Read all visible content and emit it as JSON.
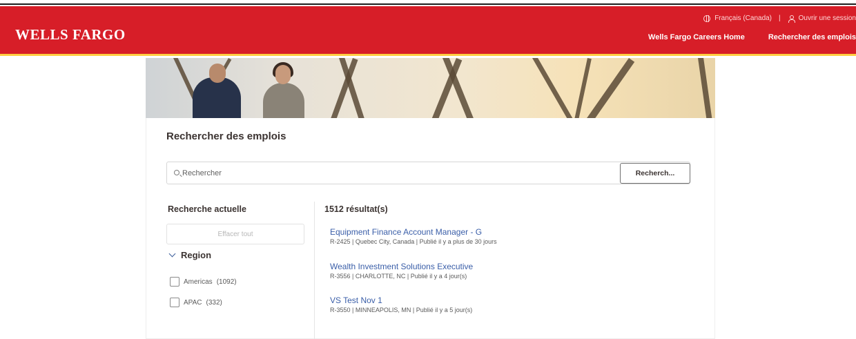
{
  "header": {
    "logo": "WELLS FARGO",
    "language": "Français (Canada)",
    "separator": "|",
    "signin": "Ouvrir une session",
    "nav": [
      "Wells Fargo Careers Home",
      "Rechercher des emplois"
    ],
    "colors": {
      "brand_red": "#d71e28",
      "accent_gold": "#ffcd41"
    }
  },
  "page": {
    "title": "Rechercher des emplois",
    "search_placeholder": "Rechercher",
    "search_button": "Recherch..."
  },
  "filters": {
    "title": "Recherche actuelle",
    "clear_all": "Effacer tout",
    "region_label": "Region",
    "options": [
      {
        "label": "Americas",
        "count": "(1092)"
      },
      {
        "label": "APAC",
        "count": "(332)"
      }
    ]
  },
  "results": {
    "count": "1512 résultat(s)",
    "jobs": [
      {
        "title": "Equipment Finance Account Manager - G",
        "meta": "R-2425  |  Quebec City, Canada  |  Publié il y a plus de 30 jours"
      },
      {
        "title": "Wealth Investment Solutions Executive",
        "meta": "R-3556  |  CHARLOTTE, NC  |  Publié il y a 4 jour(s)"
      },
      {
        "title": "VS Test Nov 1",
        "meta": "R-3550  |  MINNEAPOLIS, MN  |  Publié il y a 5 jour(s)"
      }
    ]
  },
  "icons": [
    "globe-icon",
    "user-icon",
    "search-icon",
    "chevron-down-icon"
  ]
}
